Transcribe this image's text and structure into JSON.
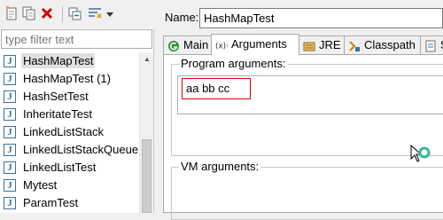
{
  "toolbar": {
    "icons": [
      "new-launch-icon",
      "duplicate-icon",
      "delete-icon",
      "collapse-all-icon",
      "filter-icon",
      "dropdown-arrow-icon"
    ]
  },
  "filter": {
    "placeholder": "type filter text"
  },
  "tree": {
    "items": [
      {
        "label": "HashMapTest",
        "selected": true
      },
      {
        "label": "HashMapTest (1)"
      },
      {
        "label": "HashSetTest"
      },
      {
        "label": "InheritateTest"
      },
      {
        "label": "LinkedListStack"
      },
      {
        "label": "LinkedListStackQueue"
      },
      {
        "label": "LinkedListTest"
      },
      {
        "label": "Mytest"
      },
      {
        "label": "ParamTest"
      }
    ]
  },
  "config": {
    "name_label": "Name:",
    "name_value": "HashMapTest"
  },
  "tabs": [
    {
      "label": "Main",
      "icon": "main-icon"
    },
    {
      "label": "Arguments",
      "icon": "arguments-icon",
      "active": true
    },
    {
      "label": "JRE",
      "icon": "jre-icon"
    },
    {
      "label": "Classpath",
      "icon": "classpath-icon"
    },
    {
      "label": "So",
      "icon": "source-icon"
    }
  ],
  "arguments": {
    "program_label": "Program arguments:",
    "program_value": "aa bb cc",
    "vm_label": "VM arguments:"
  },
  "colors": {
    "highlight_border": "#d40000",
    "selection": "#e0e0e0"
  }
}
